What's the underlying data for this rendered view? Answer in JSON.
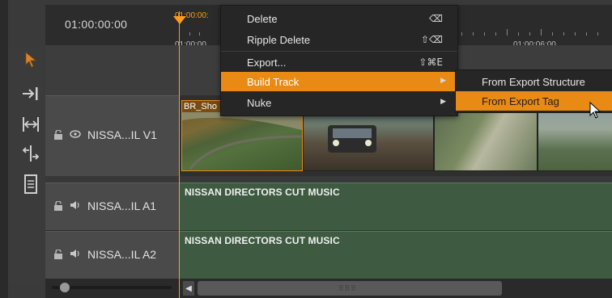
{
  "timeline": {
    "timecode": "01:00:00:00",
    "ruler_labels": [
      "01:00:00:",
      "01:00:00",
      "01:00:06:00"
    ]
  },
  "tracks": {
    "v1": {
      "name": "NISSA...IL V1",
      "clip_label": "BR_Sho"
    },
    "a1": {
      "name": "NISSA...IL A1",
      "clip_label": "NISSAN DIRECTORS CUT MUSIC"
    },
    "a2": {
      "name": "NISSA...IL A2",
      "clip_label": "NISSAN DIRECTORS CUT MUSIC"
    }
  },
  "context_menu": {
    "items": [
      {
        "label": "Delete",
        "shortcut": "⌫"
      },
      {
        "label": "Ripple Delete",
        "shortcut": "⇧⌫"
      },
      {
        "label": "Export...",
        "shortcut": "⇧⌘E"
      },
      {
        "label": "Build Track",
        "shortcut": ""
      },
      {
        "label": "Nuke",
        "shortcut": ""
      }
    ],
    "highlighted": "Build Track"
  },
  "submenu": {
    "items": [
      {
        "label": "From Export Structure"
      },
      {
        "label": "From Export Tag"
      }
    ],
    "highlighted": "From Export Tag"
  },
  "colors": {
    "accent": "#e98a14",
    "playhead": "#ff9a1c",
    "audio_track": "#3e5a40"
  }
}
